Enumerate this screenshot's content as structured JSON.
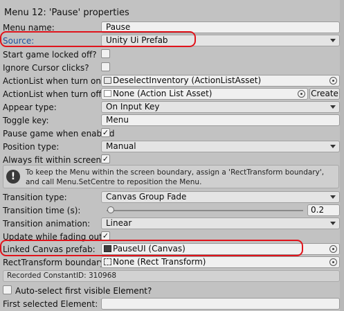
{
  "title": "Menu 12: 'Pause' properties",
  "fields": {
    "menu_name": {
      "label": "Menu name:",
      "value": "Pause"
    },
    "source": {
      "label": "Source:",
      "value": "Unity Ui Prefab"
    },
    "start_locked": {
      "label": "Start game locked off?",
      "checked": false
    },
    "ignore_cursor": {
      "label": "Ignore Cursor clicks?",
      "checked": false
    },
    "action_on": {
      "label": "ActionList when turn on:",
      "value": "DeselectInventory (ActionListAsset)"
    },
    "action_off": {
      "label": "ActionList when turn off:",
      "value": "None (Action List Asset)",
      "button": "Create"
    },
    "appear_type": {
      "label": "Appear type:",
      "value": "On Input Key"
    },
    "toggle_key": {
      "label": "Toggle key:",
      "value": "Menu"
    },
    "pause_game": {
      "label": "Pause game when enabled",
      "checked": true,
      "mark": "✓"
    },
    "position_type": {
      "label": "Position type:",
      "value": "Manual"
    },
    "always_fit": {
      "label": "Always fit within screen?",
      "checked": true,
      "mark": "✓"
    },
    "help_text": "To keep the Menu within the screen boundary, assign a 'RectTransform boundary', and call Menu.SetCentre to reposition the Menu.",
    "help_icon": "!",
    "transition_type": {
      "label": "Transition type:",
      "value": "Canvas Group Fade"
    },
    "transition_time": {
      "label": "Transition time (s):",
      "value": "0.2",
      "fraction": 0
    },
    "transition_animation": {
      "label": "Transition animation:",
      "value": "Linear"
    },
    "update_fading": {
      "label": "Update while fading out?",
      "checked": true,
      "mark": "✓"
    },
    "linked_canvas": {
      "label": "Linked Canvas prefab:",
      "value": "PauseUI (Canvas)"
    },
    "rect_boundary": {
      "label": "RectTransform boundary:",
      "value": "None (Rect Transform)"
    },
    "constant_id": "Recorded ConstantID: 310968",
    "auto_select": {
      "label": "Auto-select first visible Element?",
      "checked": false
    },
    "first_selected": {
      "label": "First selected Element:",
      "value": ""
    }
  },
  "colors": {
    "highlight": "#e0131b",
    "source_label": "#1e4f9c",
    "background": "#c2c2c2"
  }
}
